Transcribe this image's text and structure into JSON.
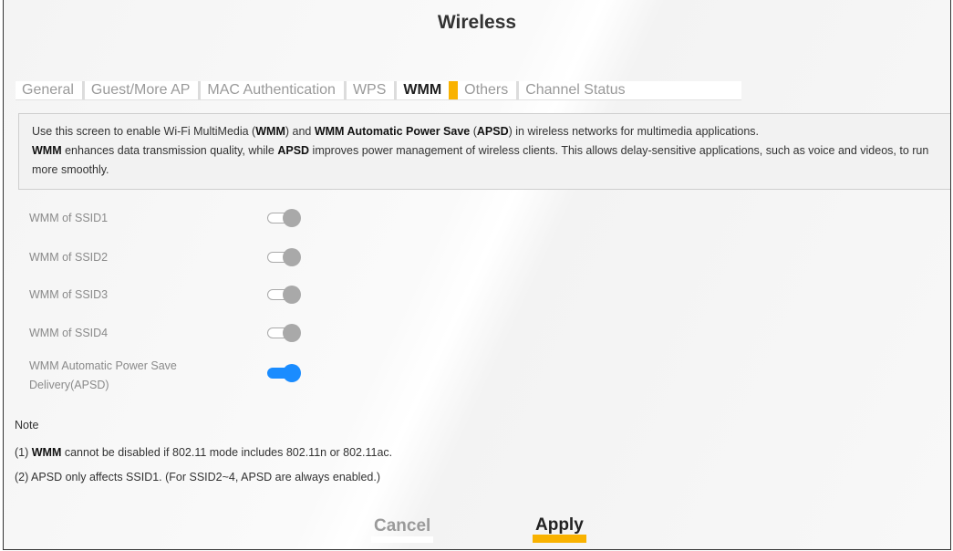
{
  "page": {
    "title": "Wireless"
  },
  "tabs": [
    {
      "label": "General",
      "active": false
    },
    {
      "label": "Guest/More AP",
      "active": false
    },
    {
      "label": "MAC Authentication",
      "active": false
    },
    {
      "label": "WPS",
      "active": false
    },
    {
      "label": "WMM",
      "active": true
    },
    {
      "label": "Others",
      "active": false
    },
    {
      "label": "Channel Status",
      "active": false
    }
  ],
  "description": {
    "p1": "Use this screen to enable Wi-Fi MultiMedia (",
    "b1": "WMM",
    "p2": ") and ",
    "b2": "WMM Automatic Power Save",
    "p3": " (",
    "b3": "APSD",
    "p4": ") in wireless networks for multimedia applications. ",
    "b4": "WMM",
    "p5": " enhances data transmission quality, while ",
    "b5": "APSD",
    "p6": " improves power management of wireless clients. This allows delay-sensitive applications, such as voice and videos, to run more smoothly."
  },
  "settings": [
    {
      "label": "WMM of SSID1",
      "enabled": true,
      "editable": false
    },
    {
      "label": "WMM of SSID2",
      "enabled": true,
      "editable": false
    },
    {
      "label": "WMM of SSID3",
      "enabled": true,
      "editable": false
    },
    {
      "label": "WMM of SSID4",
      "enabled": true,
      "editable": false
    },
    {
      "label": "WMM Automatic Power Save Delivery(APSD)",
      "label_line1": "WMM Automatic Power Save",
      "label_line2": "Delivery(APSD)",
      "enabled": true,
      "editable": true
    }
  ],
  "note": {
    "heading": "Note",
    "n1_prefix": "(1) ",
    "n1_bold": "WMM",
    "n1_rest": " cannot be disabled if 802.11 mode includes 802.11n or 802.11ac.",
    "n2": "(2) APSD only affects SSID1. (For SSID2~4, APSD are always enabled.)"
  },
  "buttons": {
    "cancel": "Cancel",
    "apply": "Apply"
  },
  "colors": {
    "accent": "#f9b200",
    "toggle_on": "#1a8cff",
    "toggle_disabled": "#a9a9a9"
  }
}
